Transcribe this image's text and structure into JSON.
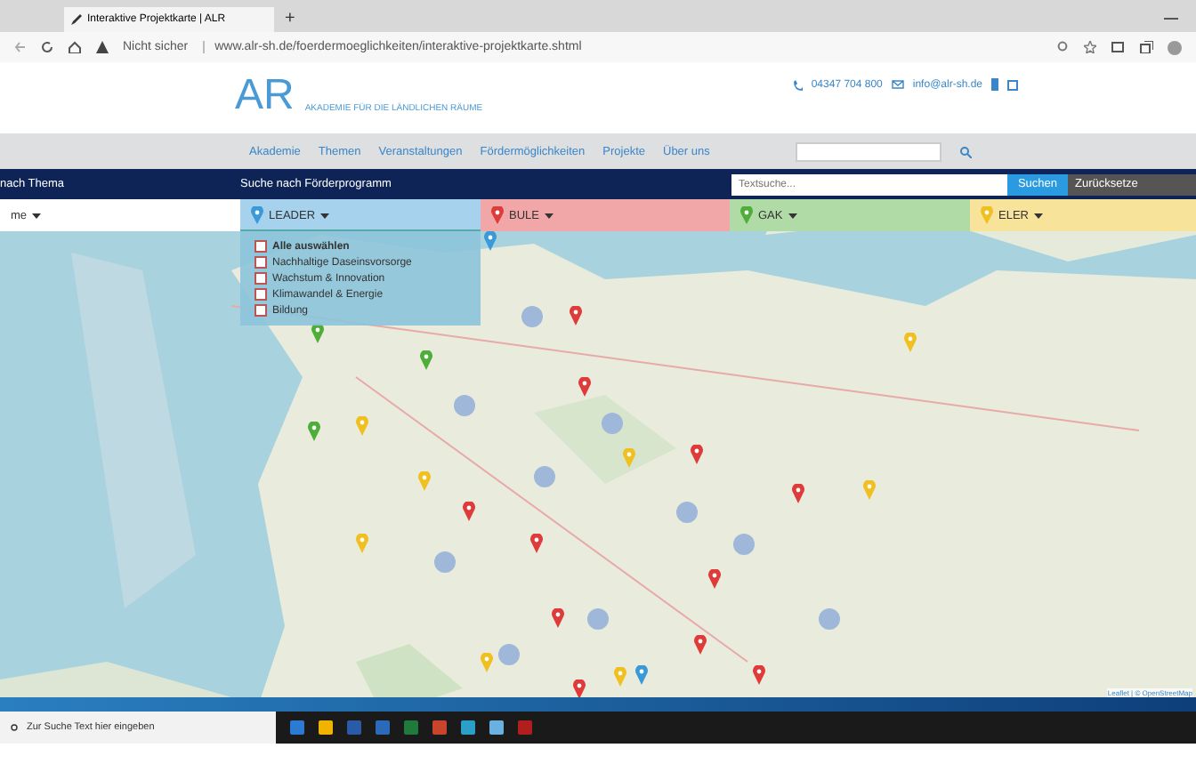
{
  "browser": {
    "tab_title": "Interaktive Projektkarte | ALR",
    "new_tab": "+",
    "security": "Nicht sicher",
    "url": "www.alr-sh.de/foerdermoeglichkeiten/interaktive-projektkarte.shtml"
  },
  "header": {
    "logo_letters": "AR",
    "logo_name": "AKADEMIE FÜR DIE LÄNDLICHEN RÄUME",
    "phone": "04347 704 800",
    "email": "info@alr-sh.de"
  },
  "nav": {
    "links": [
      "Akademie",
      "Themen",
      "Veranstaltungen",
      "Fördermöglichkeiten",
      "Projekte",
      "Über uns"
    ]
  },
  "search_bar": {
    "topic_label": "nach Thema",
    "program_label": "Suche nach Förderprogramm",
    "placeholder": "Textsuche...",
    "search_button": "Suchen",
    "reset_button": "Zurücksetze"
  },
  "filters": [
    {
      "label": "me",
      "color": "#ffffff",
      "expanded": false
    },
    {
      "label": "LEADER",
      "color": "#3a9ad9",
      "expanded": true
    },
    {
      "label": "BULE",
      "color": "#e03b3b",
      "expanded": false
    },
    {
      "label": "GAK",
      "color": "#4fae3a",
      "expanded": false
    },
    {
      "label": "ELER",
      "color": "#f0c020",
      "expanded": false
    }
  ],
  "dropdown": [
    {
      "label": "Alle auswählen",
      "checked": false
    },
    {
      "label": "Nachhaltige Daseinsvorsorge",
      "checked": false
    },
    {
      "label": "Wachstum & Innovation",
      "checked": false
    },
    {
      "label": "Klimawandel & Energie",
      "checked": false
    },
    {
      "label": "Bildung",
      "checked": false
    }
  ],
  "map": {
    "kind": "picture",
    "attribution": "Leaflet | © OpenStreetMap"
  },
  "taskbar": {
    "search_placeholder": "Zur Suche Text hier eingeben"
  }
}
